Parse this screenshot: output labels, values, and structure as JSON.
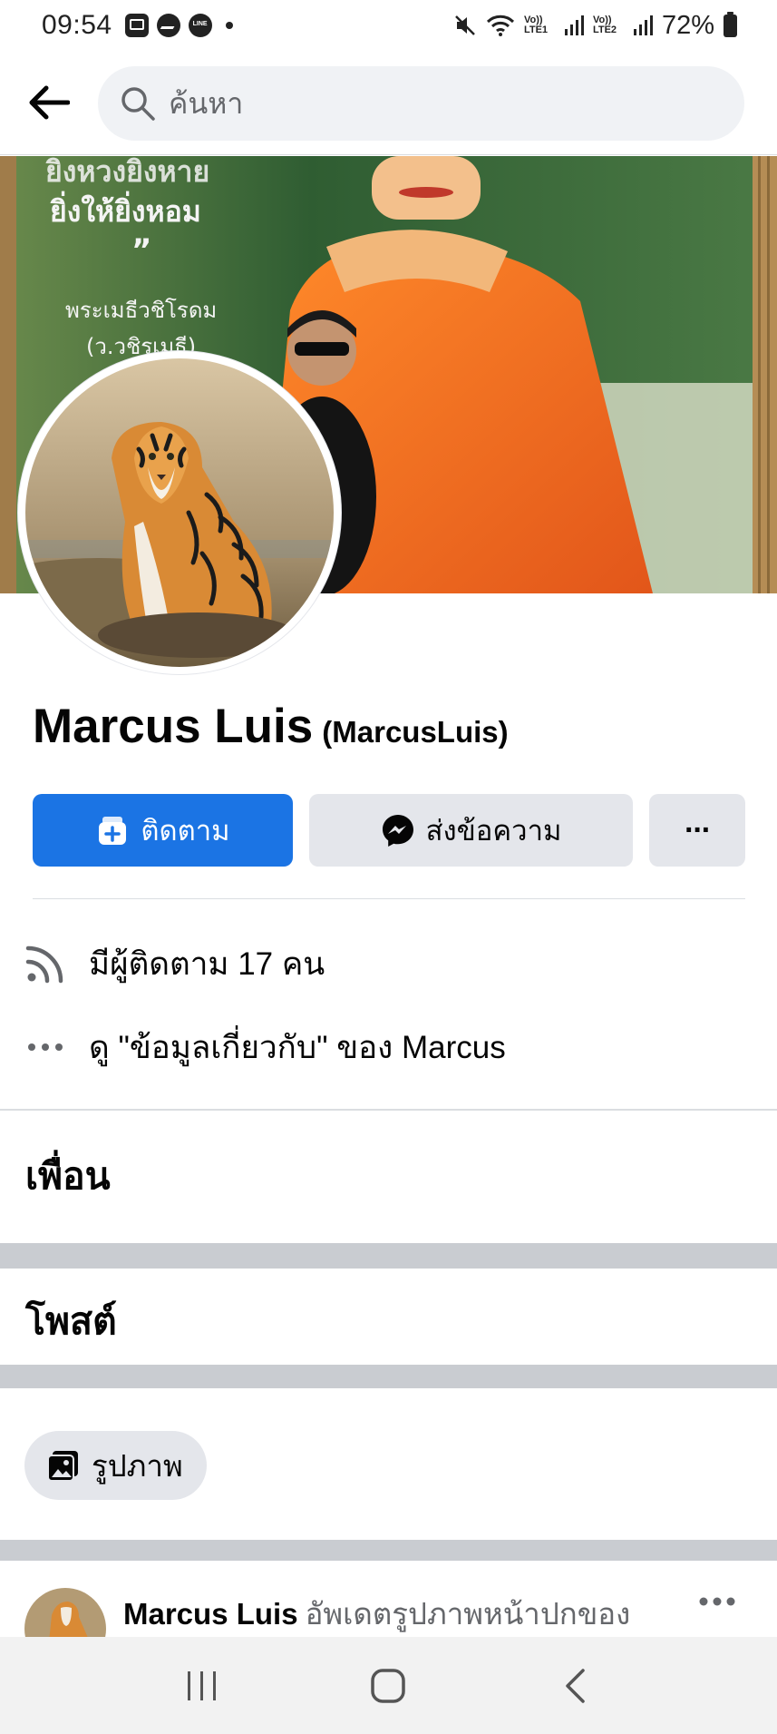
{
  "status_bar": {
    "time": "09:54",
    "lte1": "Vo)) LTE1",
    "lte2": "Vo)) LTE2",
    "battery": "72%"
  },
  "search": {
    "placeholder": "ค้นหา"
  },
  "profile": {
    "name": "Marcus Luis",
    "handle": "(MarcusLuis)"
  },
  "actions": {
    "follow_label": "ติดตาม",
    "message_label": "ส่งข้อความ",
    "more_label": "···"
  },
  "info": {
    "followers": "มีผู้ติดตาม 17 คน",
    "about": "ดู \"ข้อมูลเกี่ยวกับ\" ของ Marcus"
  },
  "sections": {
    "friends": "เพื่อน",
    "posts": "โพสต์",
    "photos_chip": "รูปภาพ"
  },
  "post": {
    "author": "Marcus Luis",
    "action": "อัพเดตรูปภาพหน้าปกของ"
  },
  "cover_text": {
    "line1": "ยิ่งให้ยิ่งหอม",
    "line2": "พระเมธีวชิโรดม",
    "line3": "(ว.วชิรเมธี)"
  },
  "colors": {
    "accent": "#1b74e4",
    "button_gray": "#e4e6eb",
    "secondary_text": "#65676b"
  },
  "icons": {
    "back": "arrow-left-icon",
    "search": "search-icon",
    "follow": "follow-plus-icon",
    "messenger": "messenger-icon",
    "followers": "rss-feed-icon",
    "about": "more-dots-icon",
    "photos": "photos-icon"
  }
}
